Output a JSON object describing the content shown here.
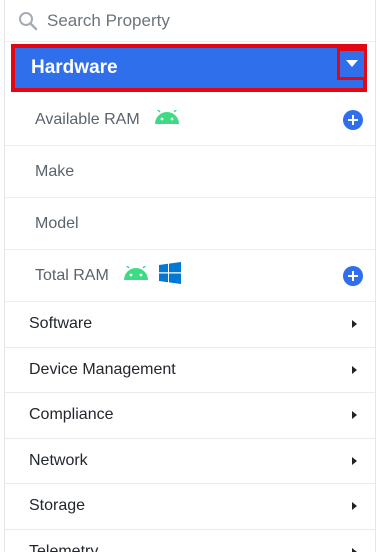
{
  "search": {
    "placeholder": "Search Property",
    "icon": "search-icon"
  },
  "active_category": {
    "label": "Hardware",
    "expanded": true,
    "color": "#2f6fec",
    "highlight_color": "#e30613",
    "items": [
      {
        "label": "Available RAM",
        "os_icons": [
          "android-icon"
        ],
        "has_add": true
      },
      {
        "label": "Make",
        "os_icons": [],
        "has_add": false
      },
      {
        "label": "Model",
        "os_icons": [],
        "has_add": false
      },
      {
        "label": "Total RAM",
        "os_icons": [
          "android-icon",
          "windows-icon"
        ],
        "has_add": true
      }
    ]
  },
  "categories": [
    {
      "label": "Software"
    },
    {
      "label": "Device Management"
    },
    {
      "label": "Compliance"
    },
    {
      "label": "Network"
    },
    {
      "label": "Storage"
    },
    {
      "label": "Telemetry"
    }
  ],
  "colors": {
    "android": "#3ddc84",
    "windows": "#0078d4",
    "accent": "#2f6fec"
  }
}
